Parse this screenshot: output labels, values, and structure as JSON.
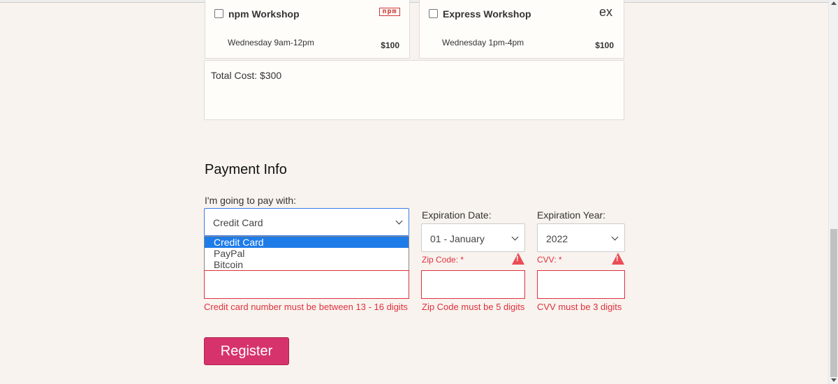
{
  "workshops": [
    {
      "title": "npm Workshop",
      "time": "Wednesday 9am-12pm",
      "price": "$100",
      "logo": "npm",
      "checked": false
    },
    {
      "title": "Express Workshop",
      "time": "Wednesday 1pm-4pm",
      "price": "$100",
      "logo": "ex",
      "checked": false
    }
  ],
  "total": "Total Cost: $300",
  "payment": {
    "title": "Payment Info",
    "method_label": "I'm going to pay with:",
    "method_value": "Credit Card",
    "method_options": [
      "Credit Card",
      "PayPal",
      "Bitcoin"
    ],
    "exp_date_label": "Expiration Date:",
    "exp_date_value": "01 - January",
    "exp_year_label": "Expiration Year:",
    "exp_year_value": "2022",
    "zip_label": "Zip Code:",
    "cvv_label": "CVV:",
    "required_marker": "*",
    "cc_error": "Credit card number must be between 13 - 16 digits",
    "zip_error": "Zip Code must be 5 digits",
    "cvv_error": "CVV must be 3 digits"
  },
  "register_label": "Register",
  "colors": {
    "accent": "#d6336c",
    "error": "#e0303e",
    "selected": "#1e7ce8"
  }
}
